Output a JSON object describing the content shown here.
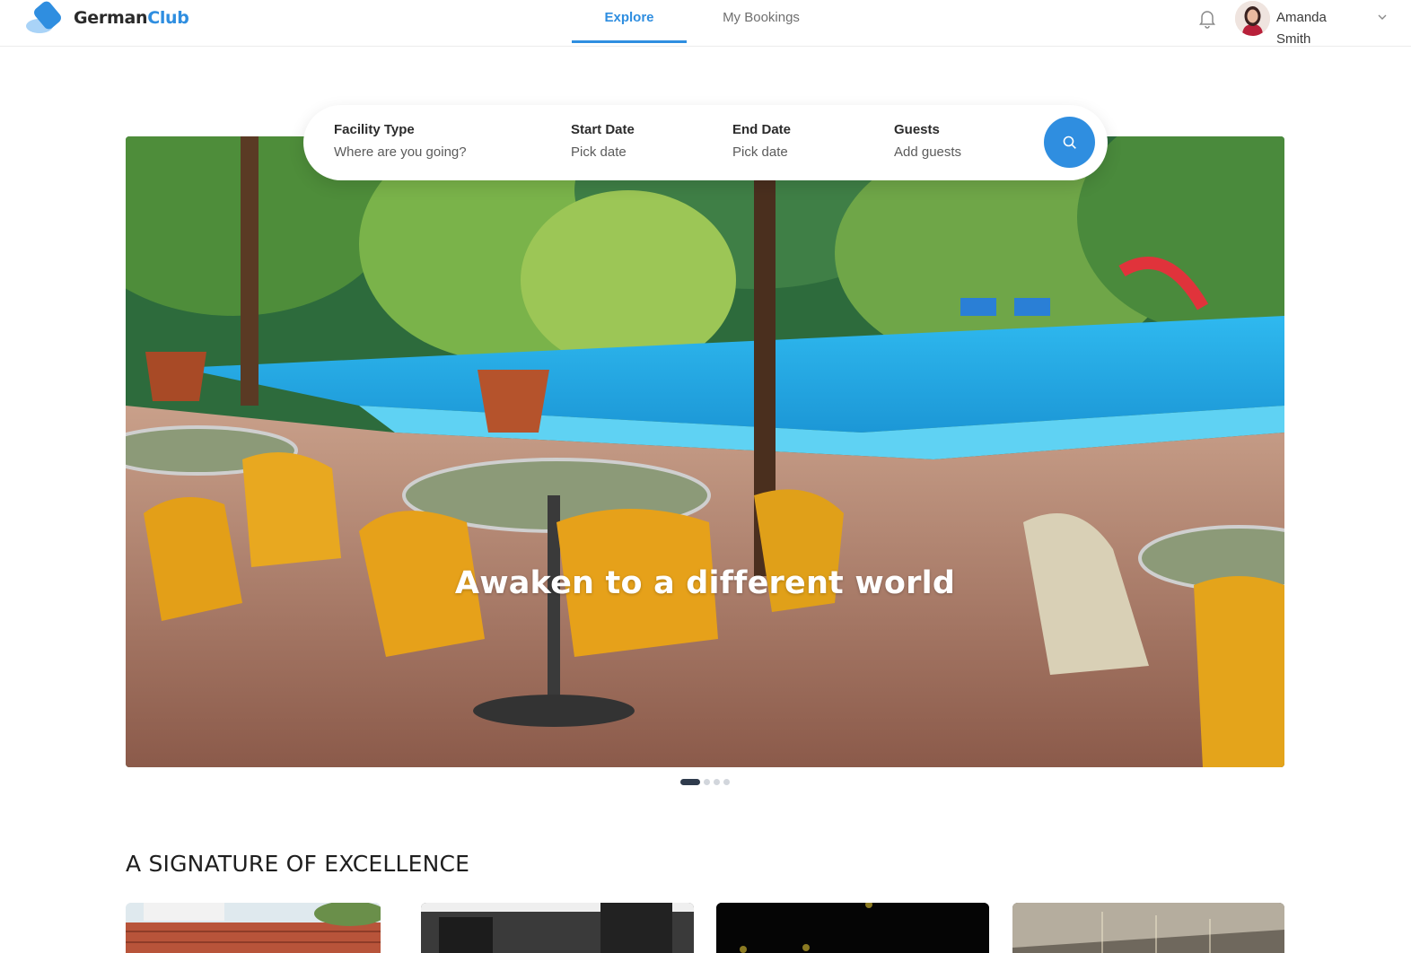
{
  "app": {
    "brand_part1": "German",
    "brand_part2": "Club",
    "brand_color": "#2f8ee0"
  },
  "nav": {
    "tabs": [
      {
        "label": "Explore",
        "active": true
      },
      {
        "label": "My Bookings",
        "active": false
      }
    ]
  },
  "user": {
    "first_name": "Amanda",
    "last_name": "Smith",
    "icons": [
      "bell-icon",
      "avatar",
      "chevron-down-icon"
    ]
  },
  "search": {
    "fields": [
      {
        "label": "Facility Type",
        "value": "Where are you going?"
      },
      {
        "label": "Start Date",
        "value": "Pick date"
      },
      {
        "label": "End Date",
        "value": "Pick date"
      },
      {
        "label": "Guests",
        "value": "Add guests"
      }
    ],
    "button_icon": "search-icon"
  },
  "hero": {
    "title": "Awaken to a different world",
    "slides_total": 4,
    "active_slide": 1
  },
  "section": {
    "title": "A SIGNATURE OF EXCELLENCE"
  }
}
